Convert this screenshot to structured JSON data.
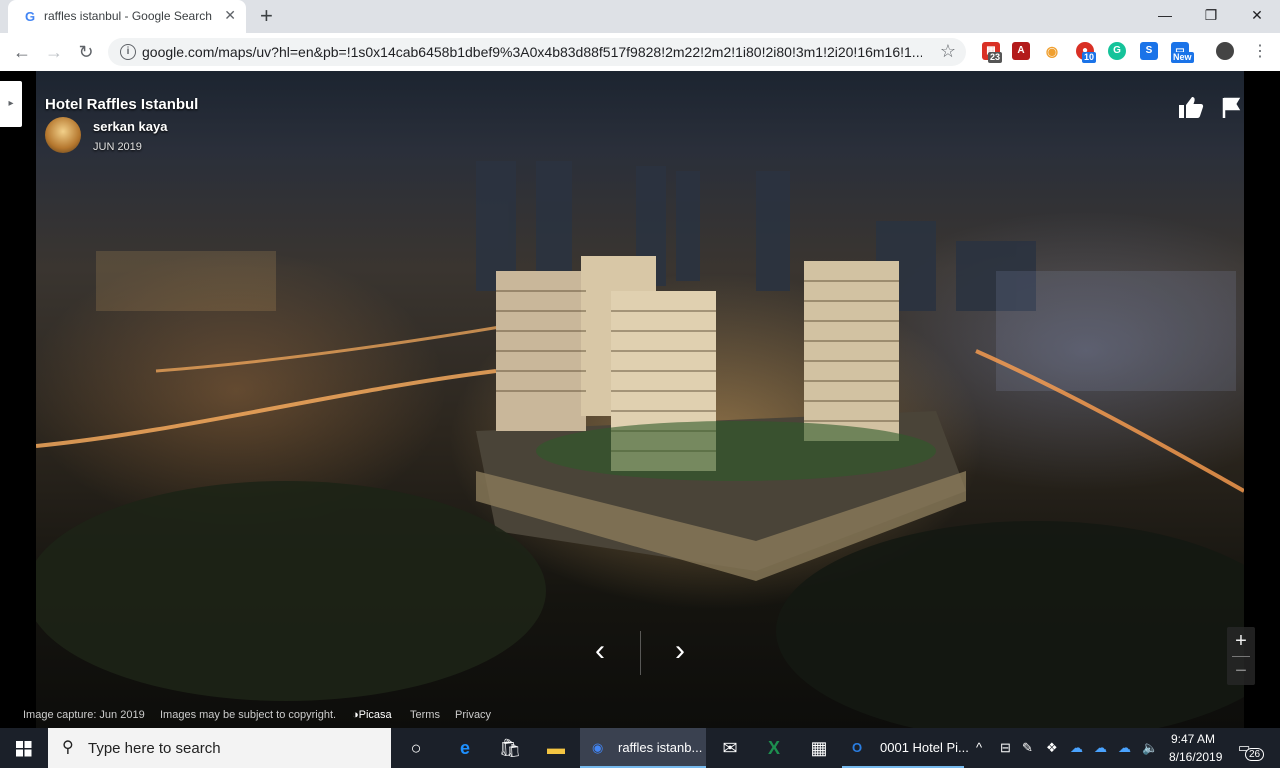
{
  "browser": {
    "tab_title": "raffles istanbul - Google Search",
    "tab_favicon": "G",
    "new_tab_label": "+",
    "window_controls": {
      "minimize": "—",
      "maximize": "❐",
      "close": "✕"
    },
    "url": "google.com/maps/uv?hl=en&pb=!1s0x14cab6458b1dbef9%3A0x4b83d88f517f9828!2m22!2m2!1i80!2i80!3m1!2i20!16m16!1...",
    "extensions": [
      {
        "name": "calendar-extension-icon",
        "badge": "23",
        "color": "#d93025"
      },
      {
        "name": "pdf-extension-icon",
        "badge": "",
        "color": "#b31b1b"
      },
      {
        "name": "eye-extension-icon",
        "badge": "",
        "color": "#f0a030"
      },
      {
        "name": "red-extension-icon",
        "badge": "10",
        "color": "#d93025"
      },
      {
        "name": "grammarly-extension-icon",
        "badge": "",
        "color": "#15c39a"
      },
      {
        "name": "s-extension-icon",
        "badge": "",
        "color": "#1a73e8"
      },
      {
        "name": "new-extension-icon",
        "badge": "New",
        "color": "#1a73e8"
      }
    ]
  },
  "viewer": {
    "title": "Hotel Raffles Istanbul",
    "author": "serkan kaya",
    "date": "JUN 2019",
    "prev_label": "‹",
    "next_label": "›",
    "zoom_in_label": "+",
    "zoom_out_label": "−",
    "footer": {
      "capture": "Image capture: Jun 2019",
      "copyright": "Images may be subject to copyright.",
      "picasa": "Picasa",
      "terms": "Terms",
      "privacy": "Privacy"
    }
  },
  "taskbar": {
    "search_placeholder": "Type here to search",
    "apps": [
      {
        "label": "raffles istanb..."
      },
      {
        "label": "0001 Hotel Pi..."
      }
    ],
    "time": "9:47 AM",
    "date": "8/16/2019",
    "notification_count": "26"
  }
}
